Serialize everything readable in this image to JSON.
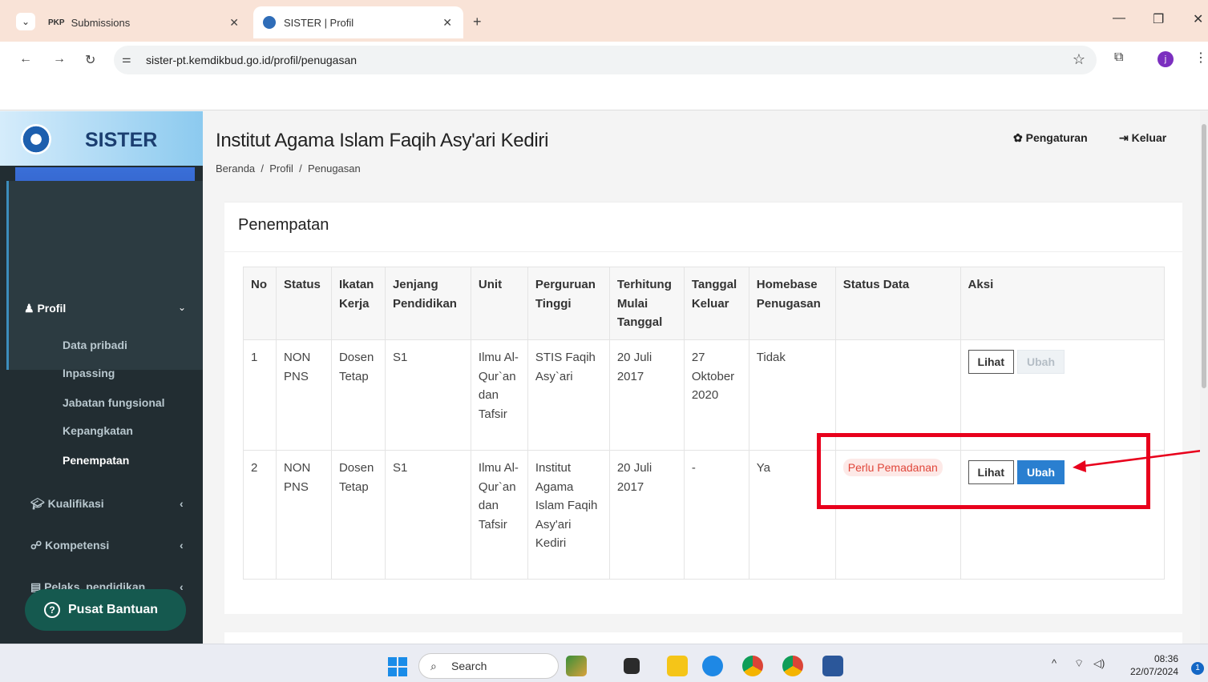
{
  "browser": {
    "tabs": [
      {
        "favicon": "PKP",
        "title": "Submissions"
      },
      {
        "title": "SISTER | Profil"
      }
    ],
    "url": "sister-pt.kemdikbud.go.id/profil/penugasan",
    "profile_initial": "j"
  },
  "sidebar": {
    "brand": "SISTER",
    "section": "Profil",
    "sub_items": [
      "Data pribadi",
      "Inpassing",
      "Jabatan fungsional",
      "Kepangkatan",
      "Penempatan"
    ],
    "items": [
      "Kualifikasi",
      "Kompetensi",
      "Pelaks. pendidikan"
    ],
    "help": "Pusat Bantuan"
  },
  "header": {
    "title": "Institut Agama Islam Faqih Asy'ari Kediri",
    "breadcrumb": [
      "Beranda",
      "Profil",
      "Penugasan"
    ],
    "settings": "Pengaturan",
    "logout": "Keluar"
  },
  "box": {
    "title": "Penempatan",
    "columns": [
      "No",
      "Status",
      "Ikatan Kerja",
      "Jenjang Pendidikan",
      "Unit",
      "Perguruan Tinggi",
      "Terhitung Mulai Tanggal",
      "Tanggal Keluar",
      "Homebase Penugasan",
      "Status Data",
      "Aksi"
    ],
    "rows": [
      {
        "no": "1",
        "status": "NON PNS",
        "ikatan": "Dosen Tetap",
        "jenjang": "S1",
        "unit": "Ilmu Al-Qur`an dan Tafsir",
        "pt": "STIS Faqih Asy`ari",
        "mulai": "20 Juli 2017",
        "keluar": "27 Oktober 2020",
        "homebase": "Tidak",
        "status_data": "",
        "lihat": "Lihat",
        "ubah": "Ubah"
      },
      {
        "no": "2",
        "status": "NON PNS",
        "ikatan": "Dosen Tetap",
        "jenjang": "S1",
        "unit": "Ilmu Al-Qur`an dan Tafsir",
        "pt": "Institut Agama Islam Faqih Asy'ari Kediri",
        "mulai": "20 Juli 2017",
        "keluar": "-",
        "homebase": "Ya",
        "status_data": "Perlu Pemadanan",
        "lihat": "Lihat",
        "ubah": "Ubah"
      }
    ]
  },
  "taskbar": {
    "search": "Search",
    "time": "08:36",
    "date": "22/07/2024",
    "notifications": "1"
  },
  "colors": {
    "sidebar_bg": "#222d32",
    "primary": "#2a7fd0",
    "highlight": "#e8001c",
    "badge_text": "#e0463a"
  }
}
